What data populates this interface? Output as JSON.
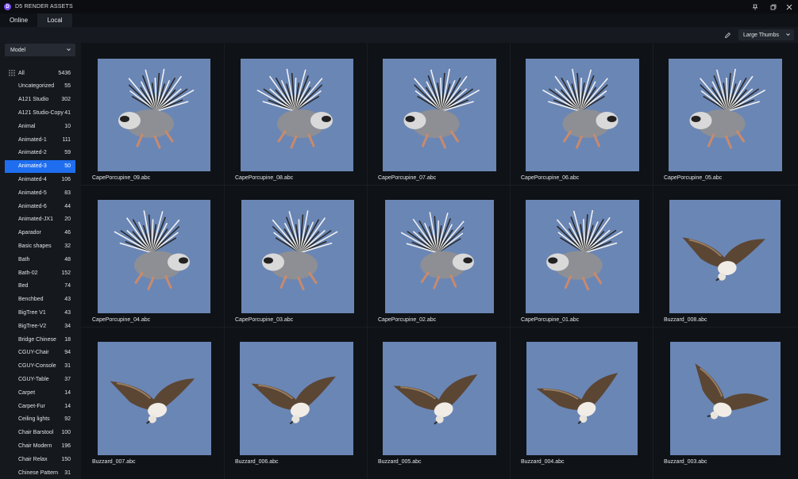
{
  "app": {
    "title": "D5 RENDER ASSETS",
    "logo_letter": "D"
  },
  "tabs": [
    {
      "label": "Online"
    },
    {
      "label": "Local"
    }
  ],
  "toolbar": {
    "view_mode": "Large Thumbs"
  },
  "sidebar": {
    "filter": "Model",
    "categories": [
      {
        "label": "All",
        "count": "5436"
      },
      {
        "label": "Uncategorized",
        "count": "55"
      },
      {
        "label": "A121 Studio",
        "count": "302"
      },
      {
        "label": "A121 Studio-Copy",
        "count": "41"
      },
      {
        "label": "Animal",
        "count": "10"
      },
      {
        "label": "Animated-1",
        "count": "111"
      },
      {
        "label": "Animated-2",
        "count": "59"
      },
      {
        "label": "Animated-3",
        "count": "50"
      },
      {
        "label": "Animated-4",
        "count": "106"
      },
      {
        "label": "Animated-5",
        "count": "83"
      },
      {
        "label": "Animated-6",
        "count": "44"
      },
      {
        "label": "Animated-JX1",
        "count": "20"
      },
      {
        "label": "Aparador",
        "count": "46"
      },
      {
        "label": "Basic shapes",
        "count": "32"
      },
      {
        "label": "Bath",
        "count": "48"
      },
      {
        "label": "Bath-02",
        "count": "152"
      },
      {
        "label": "Bed",
        "count": "74"
      },
      {
        "label": "Benchbed",
        "count": "43"
      },
      {
        "label": "BigTree V1",
        "count": "43"
      },
      {
        "label": "BigTree-V2",
        "count": "34"
      },
      {
        "label": "Bridge Chinese",
        "count": "18"
      },
      {
        "label": "CGUY-Chair",
        "count": "94"
      },
      {
        "label": "CGUY-Console",
        "count": "31"
      },
      {
        "label": "CGUY-Table",
        "count": "37"
      },
      {
        "label": "Carpet",
        "count": "14"
      },
      {
        "label": "Carpet-Fur",
        "count": "14"
      },
      {
        "label": "Ceiling lights",
        "count": "92"
      },
      {
        "label": "Chair Barstool",
        "count": "100"
      },
      {
        "label": "Chair Modern",
        "count": "196"
      },
      {
        "label": "Chair Relax",
        "count": "150"
      },
      {
        "label": "Chinese Pattern",
        "count": "31"
      }
    ],
    "selected_index": 7
  },
  "assets": [
    {
      "name": "CapePorcupine_09.abc",
      "kind": "porcupine"
    },
    {
      "name": "CapePorcupine_08.abc",
      "kind": "porcupine"
    },
    {
      "name": "CapePorcupine_07.abc",
      "kind": "porcupine"
    },
    {
      "name": "CapePorcupine_06.abc",
      "kind": "porcupine"
    },
    {
      "name": "CapePorcupine_05.abc",
      "kind": "porcupine"
    },
    {
      "name": "CapePorcupine_04.abc",
      "kind": "porcupine"
    },
    {
      "name": "CapePorcupine_03.abc",
      "kind": "porcupine"
    },
    {
      "name": "CapePorcupine_02.abc",
      "kind": "porcupine"
    },
    {
      "name": "CapePorcupine_01.abc",
      "kind": "porcupine"
    },
    {
      "name": "Buzzard_008.abc",
      "kind": "buzzard"
    },
    {
      "name": "Buzzard_007.abc",
      "kind": "buzzard"
    },
    {
      "name": "Buzzard_006.abc",
      "kind": "buzzard"
    },
    {
      "name": "Buzzard_005.abc",
      "kind": "buzzard"
    },
    {
      "name": "Buzzard_004.abc",
      "kind": "buzzard"
    },
    {
      "name": "Buzzard_003.abc",
      "kind": "buzzard"
    }
  ],
  "colors": {
    "accent": "#1f6ef0",
    "thumb_bg": "#6a86b5",
    "logo": "#7b4dff"
  }
}
